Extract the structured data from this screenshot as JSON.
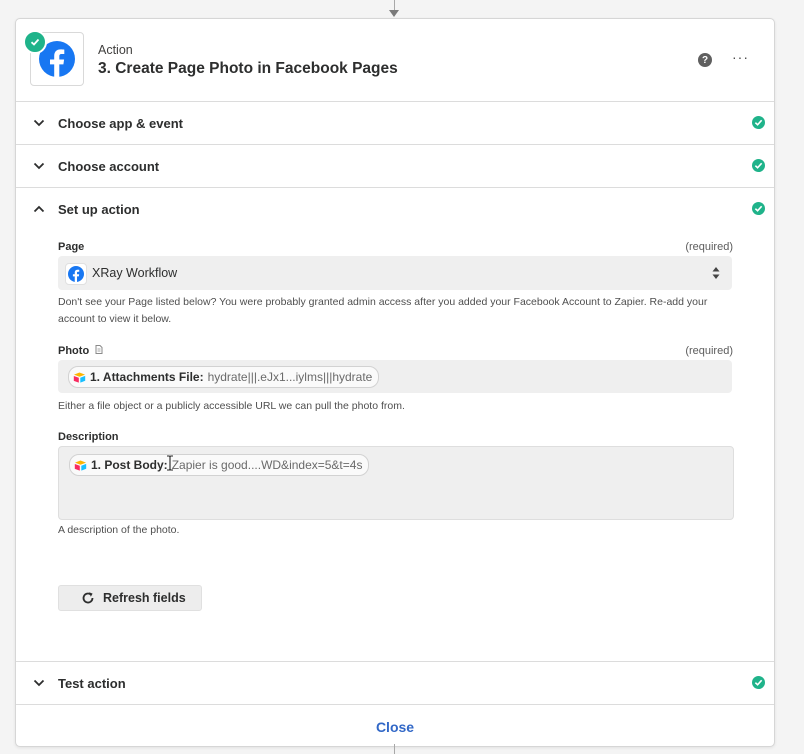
{
  "header": {
    "kicker": "Action",
    "title": "3. Create Page Photo in Facebook Pages",
    "help_glyph": "?",
    "more_glyph": "···"
  },
  "sections": {
    "choose_app": {
      "title": "Choose app & event",
      "status": "complete"
    },
    "choose_account": {
      "title": "Choose account",
      "status": "complete"
    },
    "setup_action": {
      "title": "Set up action",
      "status": "complete"
    },
    "test_action": {
      "title": "Test action",
      "status": "complete"
    }
  },
  "fields": {
    "page": {
      "label": "Page",
      "required": "(required)",
      "value": "XRay Workflow",
      "help": "Don't see your Page listed below? You were probably granted admin access after you added your Facebook Account to Zapier. Re-add your account to view it below."
    },
    "photo": {
      "label": "Photo",
      "required": "(required)",
      "pill_key": "1. Attachments File:",
      "pill_value": "hydrate|||.eJx1...iylms|||hydrate",
      "help": "Either a file object or a publicly accessible URL we can pull the photo from."
    },
    "description": {
      "label": "Description",
      "pill_key": "1. Post Body:",
      "pill_value": "Zapier is good....WD&index=5&t=4s",
      "help": "A description of the photo."
    }
  },
  "refresh_label": "Refresh fields",
  "close_label": "Close",
  "colors": {
    "success": "#1fb38a",
    "facebook": "#1877f2",
    "link": "#3268c7"
  },
  "icons": [
    "facebook-icon",
    "check-icon",
    "help-icon",
    "more-icon",
    "chevron-down-icon",
    "chevron-up-icon",
    "sort-icon",
    "file-icon",
    "airtable-icon",
    "refresh-icon",
    "text-cursor-icon"
  ]
}
